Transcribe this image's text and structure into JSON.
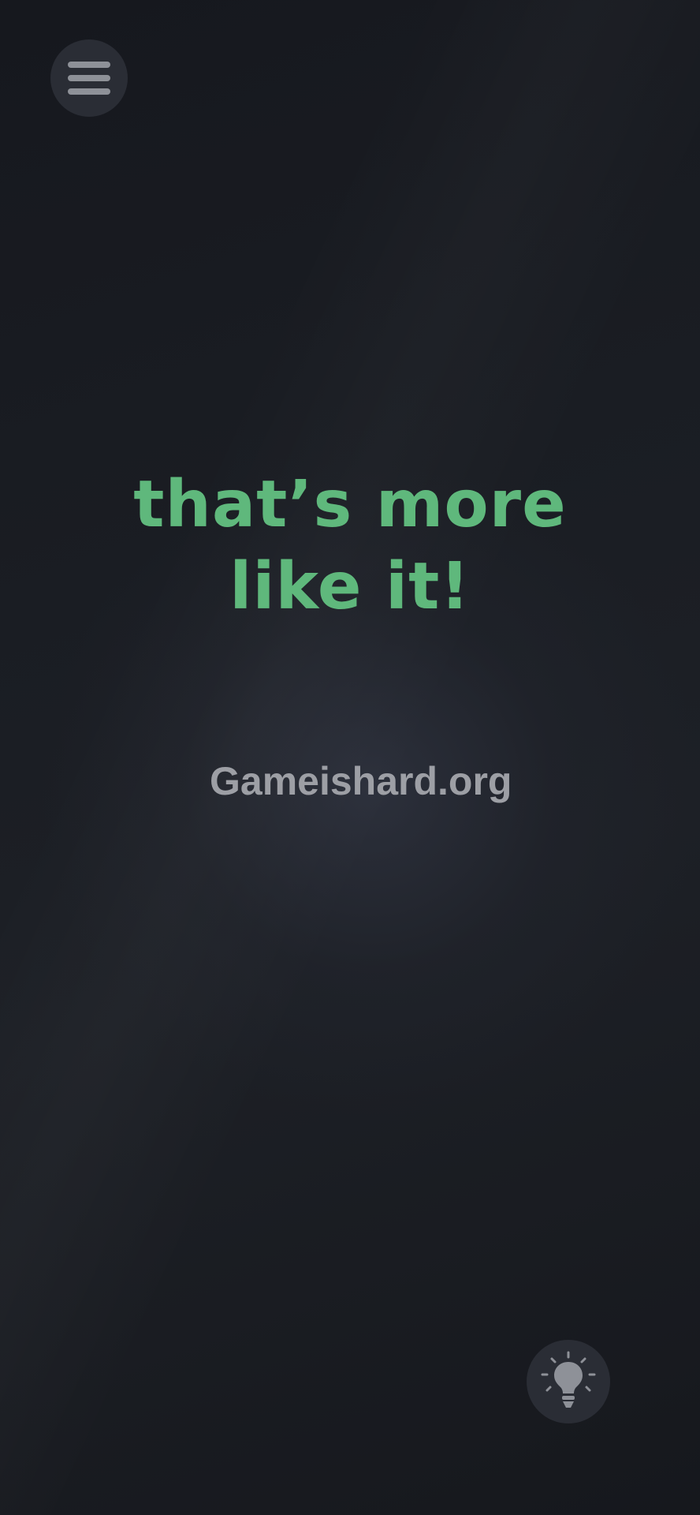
{
  "menu": {
    "icon": "hamburger-menu-icon"
  },
  "message": {
    "line1": "that’s more",
    "line2": "like it!",
    "color": "#5fb87c"
  },
  "watermark": {
    "text": "Gameishard.org"
  },
  "hint": {
    "icon": "lightbulb-icon"
  },
  "colors": {
    "background": "#181a20",
    "button_bg": "#2a2d35",
    "icon": "#8e9198"
  }
}
